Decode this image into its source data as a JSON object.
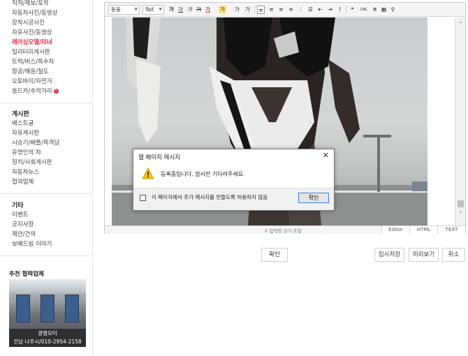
{
  "sidebar": {
    "menu1": [
      {
        "label": "직적/제보/포착"
      },
      {
        "label": "자동차사진/동영상"
      },
      {
        "label": "장착시공사진"
      },
      {
        "label": "자유사진/동영상"
      },
      {
        "label": "레이싱모델/미녀",
        "active": true
      },
      {
        "label": "밀리터리게시판"
      },
      {
        "label": "트럭/버스/특수차"
      },
      {
        "label": "항공/해운/철도"
      },
      {
        "label": "오토바이/자전거"
      },
      {
        "label": "올드카/추억거리",
        "badge": "N"
      }
    ],
    "board_title": "게시판",
    "board_items": [
      "베스트글",
      "자유게시판",
      "시승기/배틀/목격담",
      "유명인의 차",
      "정치/사회게시판",
      "자동차뉴스",
      "협력업체"
    ],
    "etc_title": "기타",
    "etc_items": [
      "이벤트",
      "공지사항",
      "제안/건의",
      "보배드림 이야기"
    ],
    "partner": {
      "title": "추천 협력업체",
      "name": "광명모터",
      "info": "전남 나주시/010-2954-2158"
    }
  },
  "editor": {
    "font_select": "돋움",
    "size_select": "9pt",
    "toolbar_buttons": [
      "가",
      "가",
      "가",
      "가",
      "가",
      "가",
      "가",
      "가",
      "가"
    ],
    "resize_label": "⇕ 입력창 크기 조절",
    "modes": [
      "Editor",
      "HTML",
      "TEXT"
    ]
  },
  "dialog": {
    "title": "웹 페이지 메시지",
    "message": "등록중입니다. 잠시만 기다려주세요.",
    "checkbox_label": "이 페이지에서 추가 메시지를 만들도록 허용하지 않음",
    "ok": "확인"
  },
  "buttons": {
    "confirm": "확인",
    "temp_save": "임시저장",
    "preview": "미리보기",
    "cancel": "취소"
  },
  "colors": {
    "accent_red": "#e0253a",
    "focus_blue": "#3a7fd5"
  }
}
